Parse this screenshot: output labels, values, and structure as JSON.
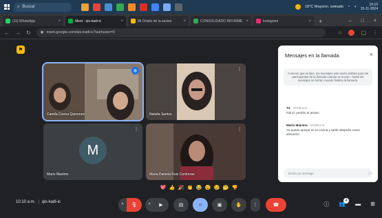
{
  "taskbar": {
    "search_placeholder": "Buscar",
    "weather": "18°C  Mayorm. soleado",
    "time": "10:10",
    "date": "15-11-2024"
  },
  "tabs": [
    {
      "label": "(11) WhatsApp",
      "color": "#25d366"
    },
    {
      "label": "Meet - qis-kadi-ic",
      "color": "#00ac47",
      "active": true
    },
    {
      "label": "Mi Ortalio de la sesion",
      "color": "#fbbc04"
    },
    {
      "label": "CONSOLIDADO INFORME",
      "color": "#34a853"
    },
    {
      "label": "Instagram",
      "color": "#e1306c"
    }
  ],
  "address": {
    "url": "meet.google.com/qis-kadi-ic?authuser=0"
  },
  "participants": [
    {
      "name": "Camila Correa Quinones",
      "speaking": true
    },
    {
      "name": "Natalia Santos"
    },
    {
      "name": "Mario Maximo",
      "initial": "M"
    },
    {
      "name": "Maria Daniela Ruiz Contreras"
    }
  ],
  "chat": {
    "title": "Mensajes en la llamada",
    "note": "A menos que se fijen, los mensajes solo serán visibles para los participantes de la llamada cuando se envíen. Todos los mensajes se borran cuando finaliza la llamada.",
    "messages": [
      {
        "sender": "Tú",
        "time": "10:09 a.m.",
        "text": "holi D: perdón el atraso"
      },
      {
        "sender": "Mario Máximo",
        "time": "10:09 a.m.",
        "text": "Yo puedo apoyar en la cocina y tarde después como almuerzo"
      }
    ],
    "input_placeholder": "Envía un mensaje"
  },
  "reactions": [
    "💖",
    "👍",
    "🎉",
    "👏",
    "😂",
    "😮",
    "😢",
    "🤔",
    "👎"
  ],
  "bottom": {
    "time": "10:10 a.m.",
    "meeting_code": "qis-kadi-ic",
    "people_badge": "4"
  }
}
